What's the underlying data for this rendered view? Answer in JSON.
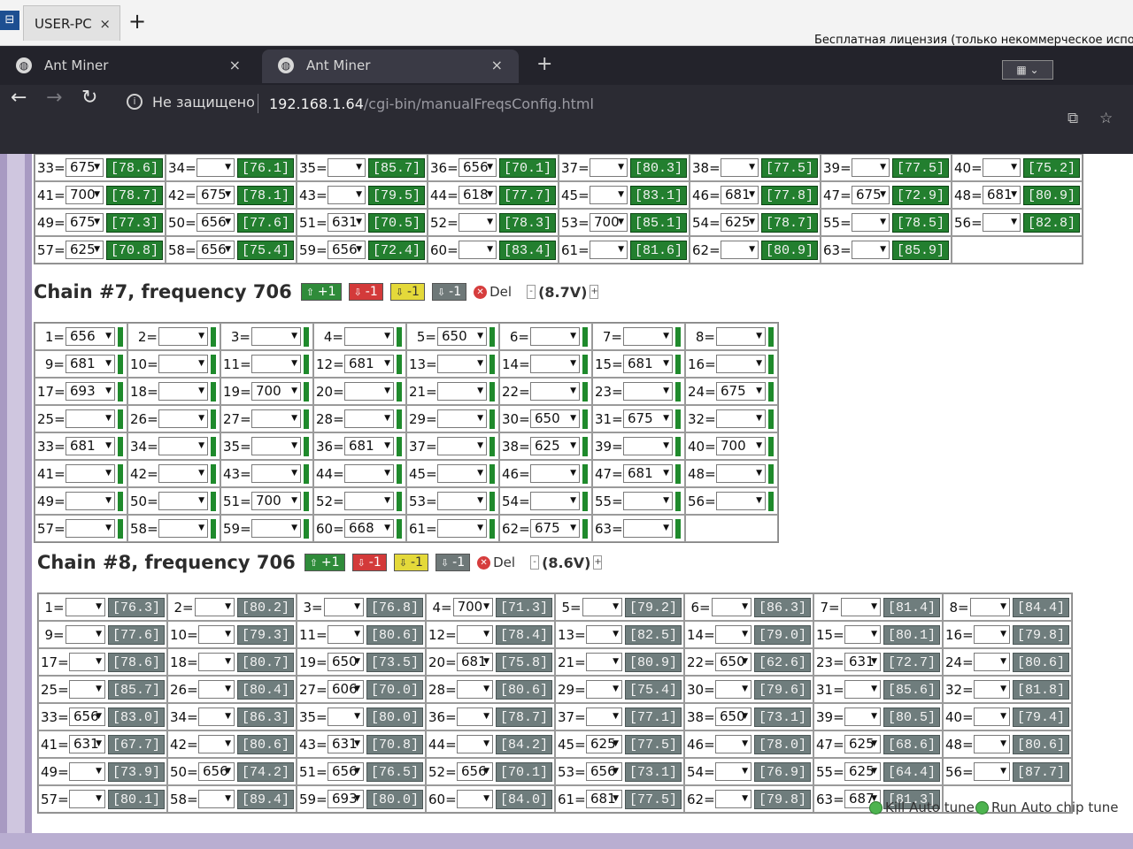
{
  "remote_session": {
    "tab_label": "USER-PC",
    "close_glyph": "×",
    "add_glyph": "+",
    "license_notice": "Бесплатная лицензия (только некоммерческое использ"
  },
  "browser": {
    "tabs": [
      {
        "label": "Ant Miner",
        "active": false
      },
      {
        "label": "Ant Miner",
        "active": true
      }
    ],
    "close_glyph": "×",
    "new_tab_glyph": "+",
    "security_label": "Не защищено",
    "url_host": "192.168.1.64",
    "url_path": "/cgi-bin/manualFreqsConfig.html",
    "icons": [
      "back-icon",
      "forward-icon",
      "reload-icon",
      "info-icon",
      "translate-icon",
      "star-icon"
    ]
  },
  "colors": {
    "temp_green": "#237f2f",
    "temp_gray": "#6f7d7d",
    "btn_up": "#2f8b3a",
    "btn_down": "#d33a3a",
    "btn_ydown": "#e4d93a",
    "btn_gdown": "#6e7878"
  },
  "chain6_partial": {
    "rows": [
      [
        [
          "33=",
          "675",
          "[78.6]"
        ],
        [
          "34=",
          "",
          "[76.1]"
        ],
        [
          "35=",
          "",
          "[85.7]"
        ],
        [
          "36=",
          "656",
          "[70.1]"
        ],
        [
          "37=",
          "",
          "[80.3]"
        ],
        [
          "38=",
          "",
          "[77.5]"
        ],
        [
          "39=",
          "",
          "[77.5]"
        ],
        [
          "40=",
          "",
          "[75.2]"
        ]
      ],
      [
        [
          "41=",
          "700",
          "[78.7]"
        ],
        [
          "42=",
          "675",
          "[78.1]"
        ],
        [
          "43=",
          "",
          "[79.5]"
        ],
        [
          "44=",
          "618",
          "[77.7]"
        ],
        [
          "45=",
          "",
          "[83.1]"
        ],
        [
          "46=",
          "681",
          "[77.8]"
        ],
        [
          "47=",
          "675",
          "[72.9]"
        ],
        [
          "48=",
          "681",
          "[80.9]"
        ]
      ],
      [
        [
          "49=",
          "675",
          "[77.3]"
        ],
        [
          "50=",
          "656",
          "[77.6]"
        ],
        [
          "51=",
          "631",
          "[70.5]"
        ],
        [
          "52=",
          "",
          "[78.3]"
        ],
        [
          "53=",
          "700",
          "[85.1]"
        ],
        [
          "54=",
          "625",
          "[78.7]"
        ],
        [
          "55=",
          "",
          "[78.5]"
        ],
        [
          "56=",
          "",
          "[82.8]"
        ]
      ],
      [
        [
          "57=",
          "625",
          "[70.8]"
        ],
        [
          "58=",
          "656",
          "[75.4]"
        ],
        [
          "59=",
          "656",
          "[72.4]"
        ],
        [
          "60=",
          "",
          "[83.4]"
        ],
        [
          "61=",
          "",
          "[81.6]"
        ],
        [
          "62=",
          "",
          "[80.9]"
        ],
        [
          "63=",
          "",
          "[85.9]"
        ]
      ]
    ]
  },
  "chain7": {
    "title": "Chain #7, frequency 706",
    "buttons": {
      "up": "+1",
      "down": "-1",
      "ydown": "-1",
      "gdown": "-1",
      "del": "Del"
    },
    "voltage": "(8.7V)",
    "vminus": "-",
    "vplus": "+",
    "rows": [
      [
        [
          "1=",
          "656"
        ],
        [
          "2=",
          ""
        ],
        [
          "3=",
          ""
        ],
        [
          "4=",
          ""
        ],
        [
          "5=",
          "650"
        ],
        [
          "6=",
          ""
        ],
        [
          "7=",
          ""
        ],
        [
          "8=",
          ""
        ]
      ],
      [
        [
          "9=",
          "681"
        ],
        [
          "10=",
          ""
        ],
        [
          "11=",
          ""
        ],
        [
          "12=",
          "681"
        ],
        [
          "13=",
          ""
        ],
        [
          "14=",
          ""
        ],
        [
          "15=",
          "681"
        ],
        [
          "16=",
          ""
        ]
      ],
      [
        [
          "17=",
          "693"
        ],
        [
          "18=",
          ""
        ],
        [
          "19=",
          "700"
        ],
        [
          "20=",
          ""
        ],
        [
          "21=",
          ""
        ],
        [
          "22=",
          ""
        ],
        [
          "23=",
          ""
        ],
        [
          "24=",
          "675"
        ]
      ],
      [
        [
          "25=",
          ""
        ],
        [
          "26=",
          ""
        ],
        [
          "27=",
          ""
        ],
        [
          "28=",
          ""
        ],
        [
          "29=",
          ""
        ],
        [
          "30=",
          "650"
        ],
        [
          "31=",
          "675"
        ],
        [
          "32=",
          ""
        ]
      ],
      [
        [
          "33=",
          "681"
        ],
        [
          "34=",
          ""
        ],
        [
          "35=",
          ""
        ],
        [
          "36=",
          "681"
        ],
        [
          "37=",
          ""
        ],
        [
          "38=",
          "625"
        ],
        [
          "39=",
          ""
        ],
        [
          "40=",
          "700"
        ]
      ],
      [
        [
          "41=",
          ""
        ],
        [
          "42=",
          ""
        ],
        [
          "43=",
          ""
        ],
        [
          "44=",
          ""
        ],
        [
          "45=",
          ""
        ],
        [
          "46=",
          ""
        ],
        [
          "47=",
          "681"
        ],
        [
          "48=",
          ""
        ]
      ],
      [
        [
          "49=",
          ""
        ],
        [
          "50=",
          ""
        ],
        [
          "51=",
          "700"
        ],
        [
          "52=",
          ""
        ],
        [
          "53=",
          ""
        ],
        [
          "54=",
          ""
        ],
        [
          "55=",
          ""
        ],
        [
          "56=",
          ""
        ]
      ],
      [
        [
          "57=",
          ""
        ],
        [
          "58=",
          ""
        ],
        [
          "59=",
          ""
        ],
        [
          "60=",
          "668"
        ],
        [
          "61=",
          ""
        ],
        [
          "62=",
          "675"
        ],
        [
          "63=",
          ""
        ]
      ]
    ]
  },
  "chain8": {
    "title": "Chain #8, frequency 706",
    "buttons": {
      "up": "+1",
      "down": "-1",
      "ydown": "-1",
      "gdown": "-1",
      "del": "Del"
    },
    "voltage": "(8.6V)",
    "vminus": "-",
    "vplus": "+",
    "rows": [
      [
        [
          "1=",
          "",
          "[76.3]"
        ],
        [
          "2=",
          "",
          "[80.2]"
        ],
        [
          "3=",
          "",
          "[76.8]"
        ],
        [
          "4=",
          "700",
          "[71.3]"
        ],
        [
          "5=",
          "",
          "[79.2]"
        ],
        [
          "6=",
          "",
          "[86.3]"
        ],
        [
          "7=",
          "",
          "[81.4]"
        ],
        [
          "8=",
          "",
          "[84.4]"
        ]
      ],
      [
        [
          "9=",
          "",
          "[77.6]"
        ],
        [
          "10=",
          "",
          "[79.3]"
        ],
        [
          "11=",
          "",
          "[80.6]"
        ],
        [
          "12=",
          "",
          "[78.4]"
        ],
        [
          "13=",
          "",
          "[82.5]"
        ],
        [
          "14=",
          "",
          "[79.0]"
        ],
        [
          "15=",
          "",
          "[80.1]"
        ],
        [
          "16=",
          "",
          "[79.8]"
        ]
      ],
      [
        [
          "17=",
          "",
          "[78.6]"
        ],
        [
          "18=",
          "",
          "[80.7]"
        ],
        [
          "19=",
          "650",
          "[73.5]"
        ],
        [
          "20=",
          "681",
          "[75.8]"
        ],
        [
          "21=",
          "",
          "[80.9]"
        ],
        [
          "22=",
          "650",
          "[62.6]"
        ],
        [
          "23=",
          "631",
          "[72.7]"
        ],
        [
          "24=",
          "",
          "[80.6]"
        ]
      ],
      [
        [
          "25=",
          "",
          "[85.7]"
        ],
        [
          "26=",
          "",
          "[80.4]"
        ],
        [
          "27=",
          "606",
          "[70.0]"
        ],
        [
          "28=",
          "",
          "[80.6]"
        ],
        [
          "29=",
          "",
          "[75.4]"
        ],
        [
          "30=",
          "",
          "[79.6]"
        ],
        [
          "31=",
          "",
          "[85.6]"
        ],
        [
          "32=",
          "",
          "[81.8]"
        ]
      ],
      [
        [
          "33=",
          "656",
          "[83.0]"
        ],
        [
          "34=",
          "",
          "[86.3]"
        ],
        [
          "35=",
          "",
          "[80.0]"
        ],
        [
          "36=",
          "",
          "[78.7]"
        ],
        [
          "37=",
          "",
          "[77.1]"
        ],
        [
          "38=",
          "650",
          "[73.1]"
        ],
        [
          "39=",
          "",
          "[80.5]"
        ],
        [
          "40=",
          "",
          "[79.4]"
        ]
      ],
      [
        [
          "41=",
          "631",
          "[67.7]"
        ],
        [
          "42=",
          "",
          "[80.6]"
        ],
        [
          "43=",
          "631",
          "[70.8]"
        ],
        [
          "44=",
          "",
          "[84.2]"
        ],
        [
          "45=",
          "625",
          "[77.5]"
        ],
        [
          "46=",
          "",
          "[78.0]"
        ],
        [
          "47=",
          "625",
          "[68.6]"
        ],
        [
          "48=",
          "",
          "[80.6]"
        ]
      ],
      [
        [
          "49=",
          "",
          "[73.9]"
        ],
        [
          "50=",
          "656",
          "[74.2]"
        ],
        [
          "51=",
          "656",
          "[76.5]"
        ],
        [
          "52=",
          "656",
          "[70.1]"
        ],
        [
          "53=",
          "656",
          "[73.1]"
        ],
        [
          "54=",
          "",
          "[76.9]"
        ],
        [
          "55=",
          "625",
          "[64.4]"
        ],
        [
          "56=",
          "",
          "[87.7]"
        ]
      ],
      [
        [
          "57=",
          "",
          "[80.1]"
        ],
        [
          "58=",
          "",
          "[89.4]"
        ],
        [
          "59=",
          "693",
          "[80.0]"
        ],
        [
          "60=",
          "",
          "[84.0]"
        ],
        [
          "61=",
          "681",
          "[77.5]"
        ],
        [
          "62=",
          "",
          "[79.8]"
        ],
        [
          "63=",
          "687",
          "[81.3]"
        ]
      ]
    ]
  },
  "actions": {
    "kill_auto_tune": "Kill Auto tune",
    "run_auto_chip_tune": "Run Auto chip tune"
  }
}
